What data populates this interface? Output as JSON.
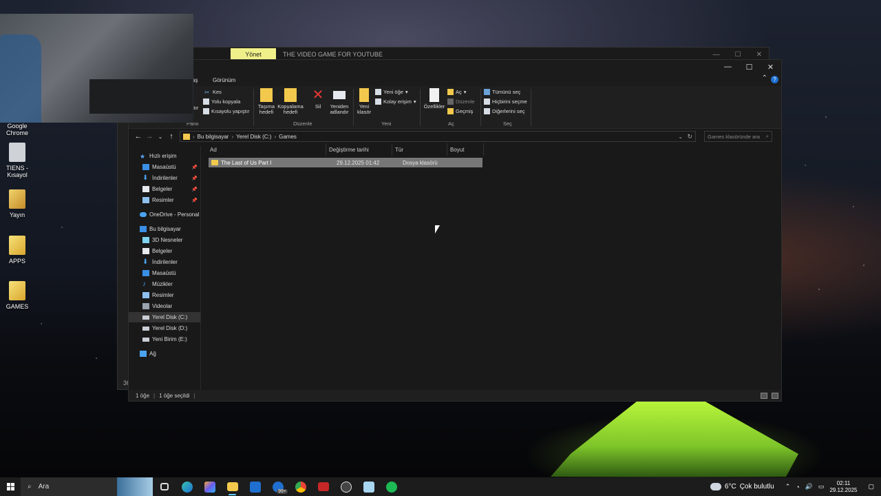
{
  "desktop": {
    "icons": [
      {
        "label": "Google Chrome"
      },
      {
        "label": "TIENS - Kısayol"
      },
      {
        "label": "Yayın"
      },
      {
        "label": "APPS"
      },
      {
        "label": "GAMES"
      }
    ]
  },
  "back_window": {
    "manage_tab": "Yönet",
    "caption": "THE VIDEO GAME FOR YOUTUBE",
    "status_count": "36"
  },
  "menubar": {
    "partial_tab": "aş",
    "view_tab": "Görünüm"
  },
  "ribbon": {
    "cut": "Kes",
    "copy_path": "Yolu kopyala",
    "paste_shortcut": "Kısayolu yapıştır",
    "paste_partial": "ştır",
    "move_to": "Taşıma hedefi",
    "copy_to": "Kopyalama hedefi",
    "delete": "Sil",
    "rename": "Yeniden adlandır",
    "new_folder": "Yeni klasör",
    "new_item": "Yeni öğe",
    "easy_access": "Kolay erişim",
    "properties": "Özellikler",
    "open": "Aç",
    "edit": "Düzenle",
    "history": "Geçmiş",
    "select_all": "Tümünü seç",
    "select_none": "Hiçbirini seçme",
    "invert_selection": "Diğerlerini seç",
    "groups": {
      "clipboard": "Pano",
      "organize": "Düzenle",
      "new": "Yeni",
      "open": "Aç",
      "select": "Seç"
    }
  },
  "address": {
    "crumbs": [
      "Bu bilgisayar",
      "Yerel Disk (C:)",
      "Games"
    ],
    "search_placeholder": "Games klasöründe ara"
  },
  "nav": {
    "quick_access": "Hızlı erişim",
    "quick_items": [
      "Masaüstü",
      "İndirilenler",
      "Belgeler",
      "Resimler"
    ],
    "onedrive": "OneDrive - Personal",
    "this_pc": "Bu bilgisayar",
    "pc_items": [
      "3D Nesneler",
      "Belgeler",
      "İndirilenler",
      "Masaüstü",
      "Müzikler",
      "Resimler",
      "Videolar",
      "Yerel Disk (C:)",
      "Yerel Disk (D:)",
      "Yeni Birim (E:)"
    ],
    "network": "Ağ"
  },
  "columns": {
    "name": "Ad",
    "date": "Değiştirme tarihi",
    "type": "Tür",
    "size": "Boyut"
  },
  "files": [
    {
      "name": "The Last of Us Part I",
      "date": "29.12.2025 01:42",
      "type": "Dosya klasörü",
      "size": ""
    }
  ],
  "status": {
    "count": "1 öğe",
    "selected": "1 öğe seçildi"
  },
  "taskbar": {
    "search_label": "Ara",
    "mail_badge": "99+",
    "weather_temp": "6°C",
    "weather_desc": "Çok bulutlu",
    "time": "02:11",
    "date": "29.12.2025"
  },
  "colors": {
    "accent": "#60cdff",
    "folder": "#f2c94c",
    "selection": "#777777",
    "manage_tab": "#f0f08a"
  }
}
